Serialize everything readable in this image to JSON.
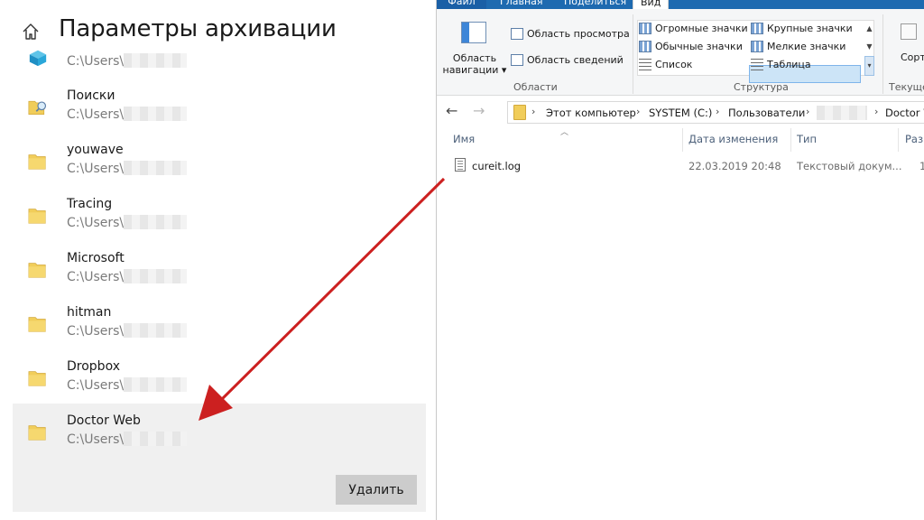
{
  "settings": {
    "title": "Параметры архивации",
    "folders": [
      {
        "name": "",
        "path": "C:\\Users\\",
        "icon": "3d-objects-icon"
      },
      {
        "name": "Поиски",
        "path": "C:\\Users\\",
        "icon": "searches-folder-icon"
      },
      {
        "name": "youwave",
        "path": "C:\\Users\\",
        "icon": "folder-icon"
      },
      {
        "name": "Tracing",
        "path": "C:\\Users\\",
        "icon": "folder-icon"
      },
      {
        "name": "Microsoft",
        "path": "C:\\Users\\",
        "icon": "folder-icon"
      },
      {
        "name": "hitman",
        "path": "C:\\Users\\",
        "icon": "folder-icon"
      },
      {
        "name": "Dropbox",
        "path": "C:\\Users\\",
        "icon": "folder-icon"
      },
      {
        "name": "Doctor Web",
        "path": "C:\\Users\\",
        "icon": "folder-icon",
        "selected": true
      }
    ],
    "delete_label": "Удалить"
  },
  "explorer": {
    "tabs": [
      "Файл",
      "Главная",
      "Поделиться",
      "Вид"
    ],
    "active_tab": "Вид",
    "ribbon": {
      "nav_pane_label_1": "Область",
      "nav_pane_label_2": "навигации",
      "preview_pane": "Область просмотра",
      "details_pane": "Область сведений",
      "group_panes": "Области",
      "layout": {
        "extra_large": "Огромные значки",
        "large": "Крупные значки",
        "medium": "Обычные значки",
        "small": "Мелкие значки",
        "list": "Список",
        "details": "Таблица"
      },
      "group_layout": "Структура",
      "sort_label": "Сорт",
      "group_current": "Текущее"
    },
    "breadcrumbs": [
      "Этот компьютер",
      "SYSTEM (C:)",
      "Пользователи",
      "",
      "Doctor W"
    ],
    "columns": {
      "name": "Имя",
      "date": "Дата изменения",
      "type": "Тип",
      "size": "Разм"
    },
    "files": [
      {
        "name": "cureit.log",
        "date": "22.03.2019 20:48",
        "type": "Текстовый докум...",
        "size": "1"
      }
    ]
  },
  "colors": {
    "accent": "#1e6ab0",
    "arrow": "#cc2020",
    "selection": "#cce4f7",
    "folder": "#f1cd5a"
  }
}
